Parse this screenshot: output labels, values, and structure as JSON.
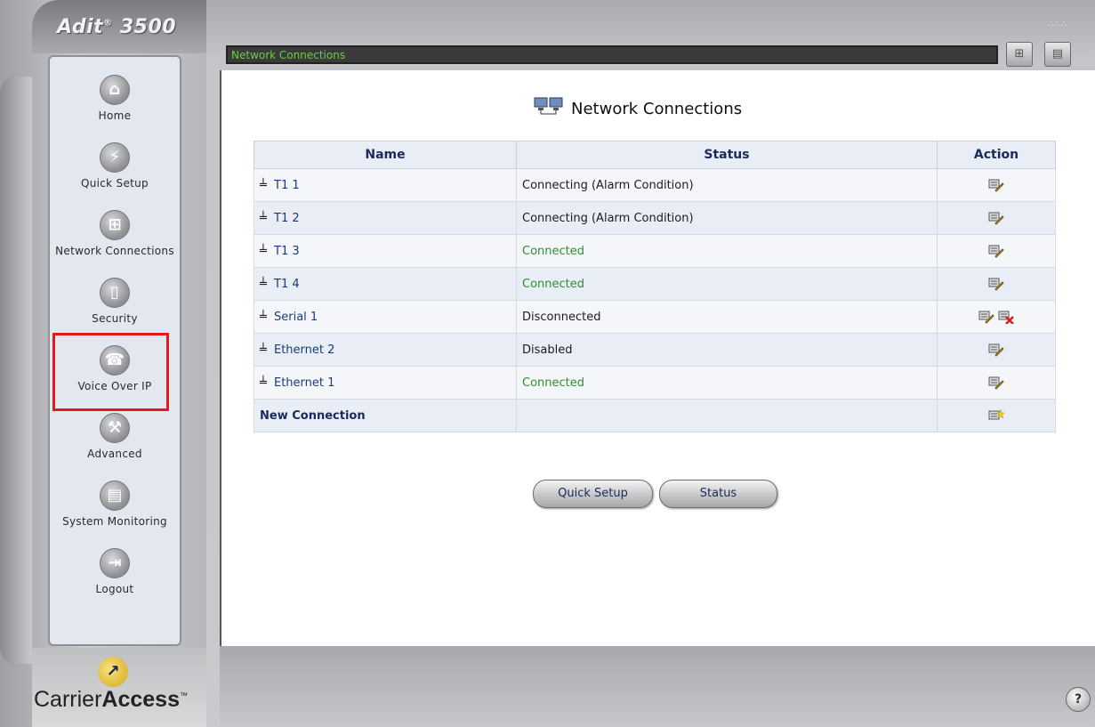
{
  "app": {
    "product_name": "Adit",
    "product_reg": "®",
    "product_model": "3500",
    "logo_text_light": "Carrier",
    "logo_text_bold": "Access",
    "logo_tm": "™"
  },
  "sidebar": {
    "items": [
      {
        "label": "Home",
        "icon": "home-icon",
        "glyph": "⌂"
      },
      {
        "label": "Quick Setup",
        "icon": "lightning-icon",
        "glyph": "⚡"
      },
      {
        "label": "Network Connections",
        "icon": "network-icon",
        "glyph": "⊞"
      },
      {
        "label": "Security",
        "icon": "lock-icon",
        "glyph": "▯"
      },
      {
        "label": "Voice Over IP",
        "icon": "phone-icon",
        "glyph": "☎"
      },
      {
        "label": "Advanced",
        "icon": "tools-icon",
        "glyph": "⚒"
      },
      {
        "label": "System Monitoring",
        "icon": "monitor-icon",
        "glyph": "▤"
      },
      {
        "label": "Logout",
        "icon": "logout-icon",
        "glyph": "⇥"
      }
    ],
    "highlighted": "Voice Over IP"
  },
  "title_bar": {
    "text": "Network Connections",
    "buttons": [
      "network-map-icon",
      "list-view-icon"
    ]
  },
  "page": {
    "heading": "Network Connections"
  },
  "table": {
    "headers": {
      "name": "Name",
      "status": "Status",
      "action": "Action"
    },
    "rows": [
      {
        "name": "T1 1",
        "status": "Connecting (Alarm Condition)",
        "status_color": "#1c1c1c",
        "actions": [
          "edit"
        ]
      },
      {
        "name": "T1 2",
        "status": "Connecting (Alarm Condition)",
        "status_color": "#1c1c1c",
        "actions": [
          "edit"
        ]
      },
      {
        "name": "T1 3",
        "status": "Connected",
        "status_color": "#2f8f2f",
        "actions": [
          "edit"
        ]
      },
      {
        "name": "T1 4",
        "status": "Connected",
        "status_color": "#2f8f2f",
        "actions": [
          "edit"
        ]
      },
      {
        "name": "Serial 1",
        "status": "Disconnected",
        "status_color": "#1c1c1c",
        "actions": [
          "edit",
          "delete"
        ]
      },
      {
        "name": "Ethernet 2",
        "status": "Disabled",
        "status_color": "#1c1c1c",
        "actions": [
          "edit"
        ]
      },
      {
        "name": "Ethernet 1",
        "status": "Connected",
        "status_color": "#2f8f2f",
        "actions": [
          "edit"
        ]
      }
    ],
    "new_connection_label": "New Connection"
  },
  "buttons": {
    "quick_setup": "Quick Setup",
    "status": "Status"
  },
  "help": {
    "glyph": "?"
  },
  "colors": {
    "title_text": "#6ccf3a",
    "link": "#1a3a7a",
    "connected": "#2f8f2f",
    "highlight_border": "#e81818"
  }
}
